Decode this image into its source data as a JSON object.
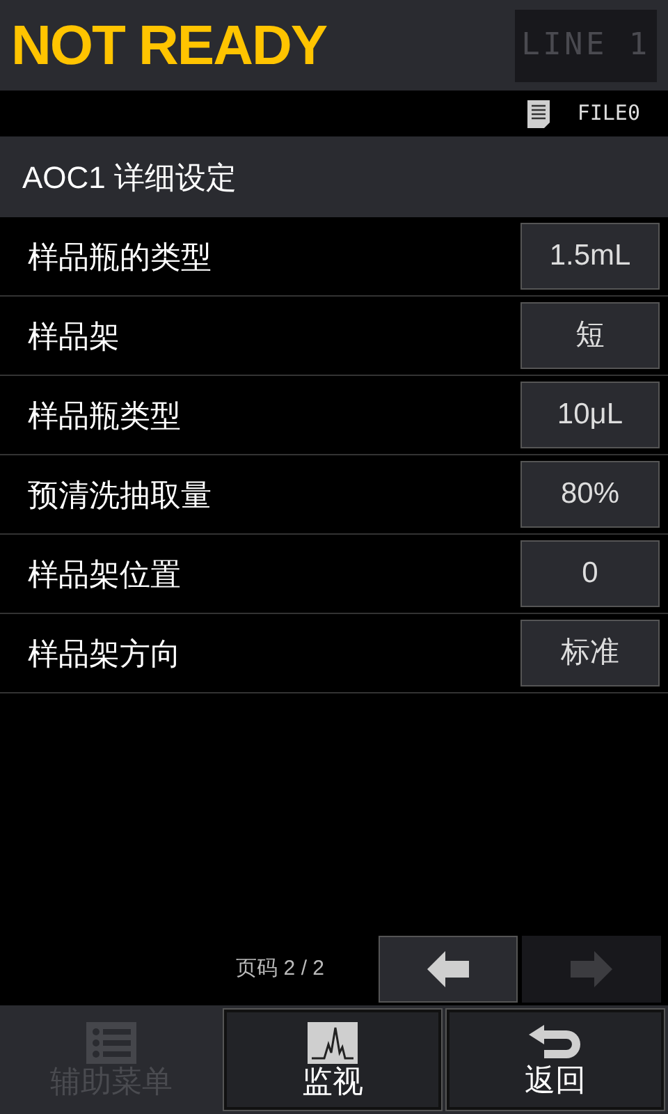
{
  "status": "NOT READY",
  "line_button": {
    "label": "LINE 1",
    "disabled": true
  },
  "file": "FILE0",
  "section_title": "AOC1 详细设定",
  "settings": [
    {
      "label": "样品瓶的类型",
      "value": "1.5mL"
    },
    {
      "label": "样品架",
      "value": "短"
    },
    {
      "label": "样品瓶类型",
      "value": "10μL"
    },
    {
      "label": "预清洗抽取量",
      "value": "80%"
    },
    {
      "label": "样品架位置",
      "value": "0"
    },
    {
      "label": "样品架方向",
      "value": "标准"
    }
  ],
  "pager": {
    "label": "页码 2 / 2",
    "prev_disabled": false,
    "next_disabled": true
  },
  "bottom_buttons": [
    {
      "kind": "menu",
      "label": "辅助菜单",
      "disabled": true
    },
    {
      "kind": "monitor",
      "label": "监视",
      "disabled": false
    },
    {
      "kind": "back",
      "label": "返回",
      "disabled": false
    }
  ]
}
